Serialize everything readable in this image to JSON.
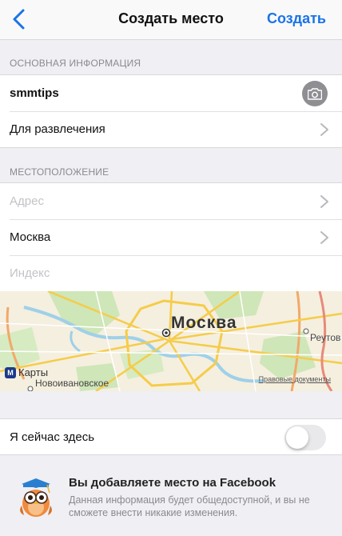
{
  "navbar": {
    "title": "Создать место",
    "action_label": "Создать",
    "back_icon": "chevron-left-icon"
  },
  "basic_info": {
    "header": "ОСНОВНАЯ ИНФОРМАЦИЯ",
    "name_value": "smmtips",
    "category_value": "Для развлечения",
    "camera_icon": "camera-icon"
  },
  "location": {
    "header": "МЕСТОПОЛОЖЕНИЕ",
    "address_placeholder": "Адрес",
    "city_value": "Москва",
    "postal_placeholder": "Индекс"
  },
  "map": {
    "city_label": "Москва",
    "place_left": "Новоивановское",
    "place_right": "Реутов",
    "logo_box": "M",
    "logo_text": "Карты",
    "legal_label": "Правовые документы"
  },
  "presence": {
    "label": "Я сейчас здесь",
    "toggle_on": false
  },
  "facebook_notice": {
    "title": "Вы добавляете место на Facebook",
    "description": "Данная информация будет общедоступной, и вы не сможете внести никакие изменения."
  },
  "colors": {
    "accent": "#1a73e8",
    "background": "#efeff4",
    "placeholder": "#c3c3c8"
  }
}
